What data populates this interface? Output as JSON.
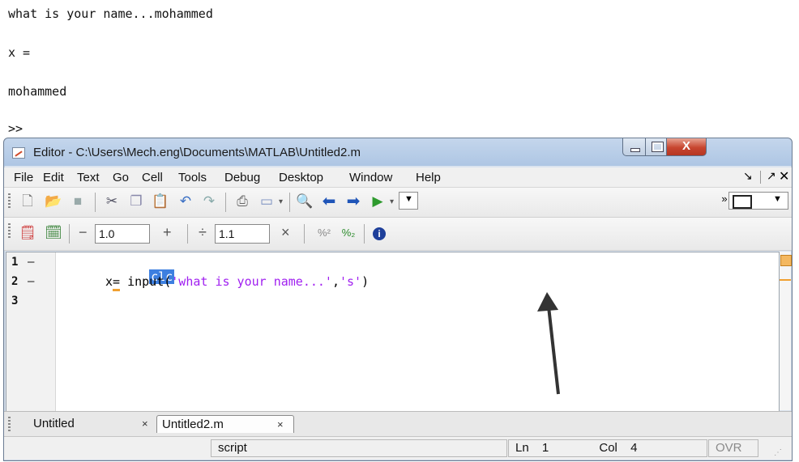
{
  "command_window": {
    "lines": [
      "what is your name...mohammed",
      "x =",
      "mohammed",
      ">>"
    ]
  },
  "editor": {
    "title": "Editor - C:\\Users\\Mech.eng\\Documents\\MATLAB\\Untitled2.m",
    "window_buttons": {
      "close": "X"
    },
    "menu": [
      "File",
      "Edit",
      "Text",
      "Go",
      "Cell",
      "Tools",
      "Debug",
      "Desktop",
      "Window",
      "Help"
    ],
    "toolbar2": {
      "minus": "−",
      "cell_value_1": "1.0",
      "plus": "+",
      "divide": "÷",
      "cell_value_2": "1.1",
      "times": "×"
    },
    "code": {
      "line_numbers": [
        "1",
        "2",
        "3"
      ],
      "line1": "clc",
      "line2_var": "x",
      "line2_eq": "=",
      "line2_func": " input(",
      "line2_str1": "'what is your name...'",
      "line2_comma": ",",
      "line2_str2": "'s'",
      "line2_close": ")"
    },
    "tabs": [
      {
        "label": "Untitled",
        "close": "×"
      },
      {
        "label": "Untitled2.m",
        "close": "×"
      }
    ],
    "status": {
      "mode": "script",
      "ln_label": "Ln",
      "ln_value": "1",
      "col_label": "Col",
      "col_value": "4",
      "ovr": "OVR"
    }
  },
  "colors": {
    "string": "#a020f0",
    "selection": "#3d7fe0",
    "analyzer_warning": "#f0a030"
  }
}
